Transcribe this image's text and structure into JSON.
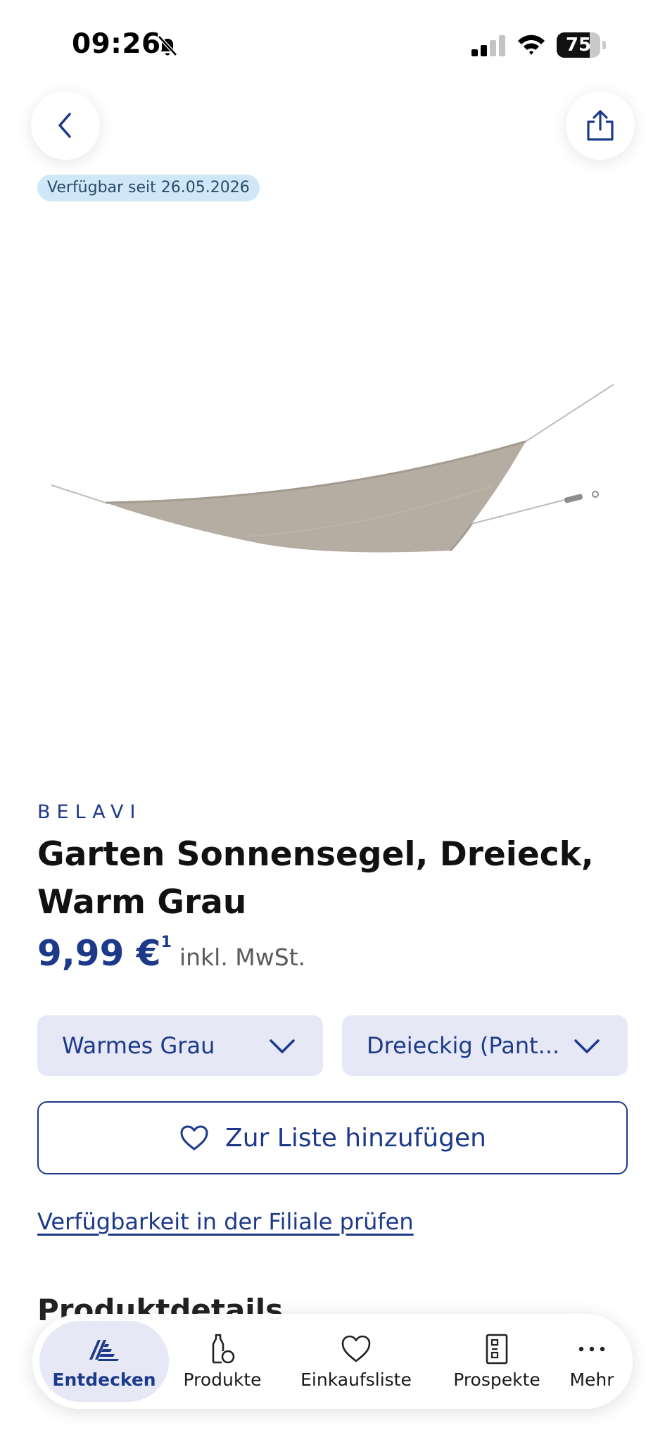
{
  "status_bar": {
    "time": "09:26",
    "battery_level": "75",
    "battery_fraction": 0.75
  },
  "header": {
    "back_icon": "chevron-left-icon",
    "share_icon": "share-icon"
  },
  "availability_badge": "Verfügbar seit 26.05.2026",
  "product": {
    "brand": "BELAVI",
    "title": "Garten Sonnensegel, Dreieck, Warm Grau",
    "price": "9,99 €",
    "price_footnote": "1",
    "price_note": "inkl. MwSt."
  },
  "options": {
    "color_value": "Warmes Grau",
    "shape_value": "Dreieckig (Pant..."
  },
  "actions": {
    "add_to_list_label": "Zur Liste hinzufügen",
    "store_availability_link": "Verfügbarkeit in der Filiale prüfen"
  },
  "sections": {
    "product_details_heading": "Produktdetails"
  },
  "bottom_nav": {
    "items": [
      {
        "label": "Entdecken",
        "icon": "aldi-logo-icon",
        "active": true
      },
      {
        "label": "Produkte",
        "icon": "bottle-icon",
        "active": false
      },
      {
        "label": "Einkaufsliste",
        "icon": "heart-icon",
        "active": false
      },
      {
        "label": "Prospekte",
        "icon": "brochure-icon",
        "active": false
      },
      {
        "label": "Mehr",
        "icon": "more-dots-icon",
        "active": false
      }
    ]
  },
  "colors": {
    "brand_blue": "#1d3a8a",
    "select_bg": "#e6e9f5",
    "badge_bg": "#cfe7f7",
    "sail_fabric": "#b5aca2"
  }
}
